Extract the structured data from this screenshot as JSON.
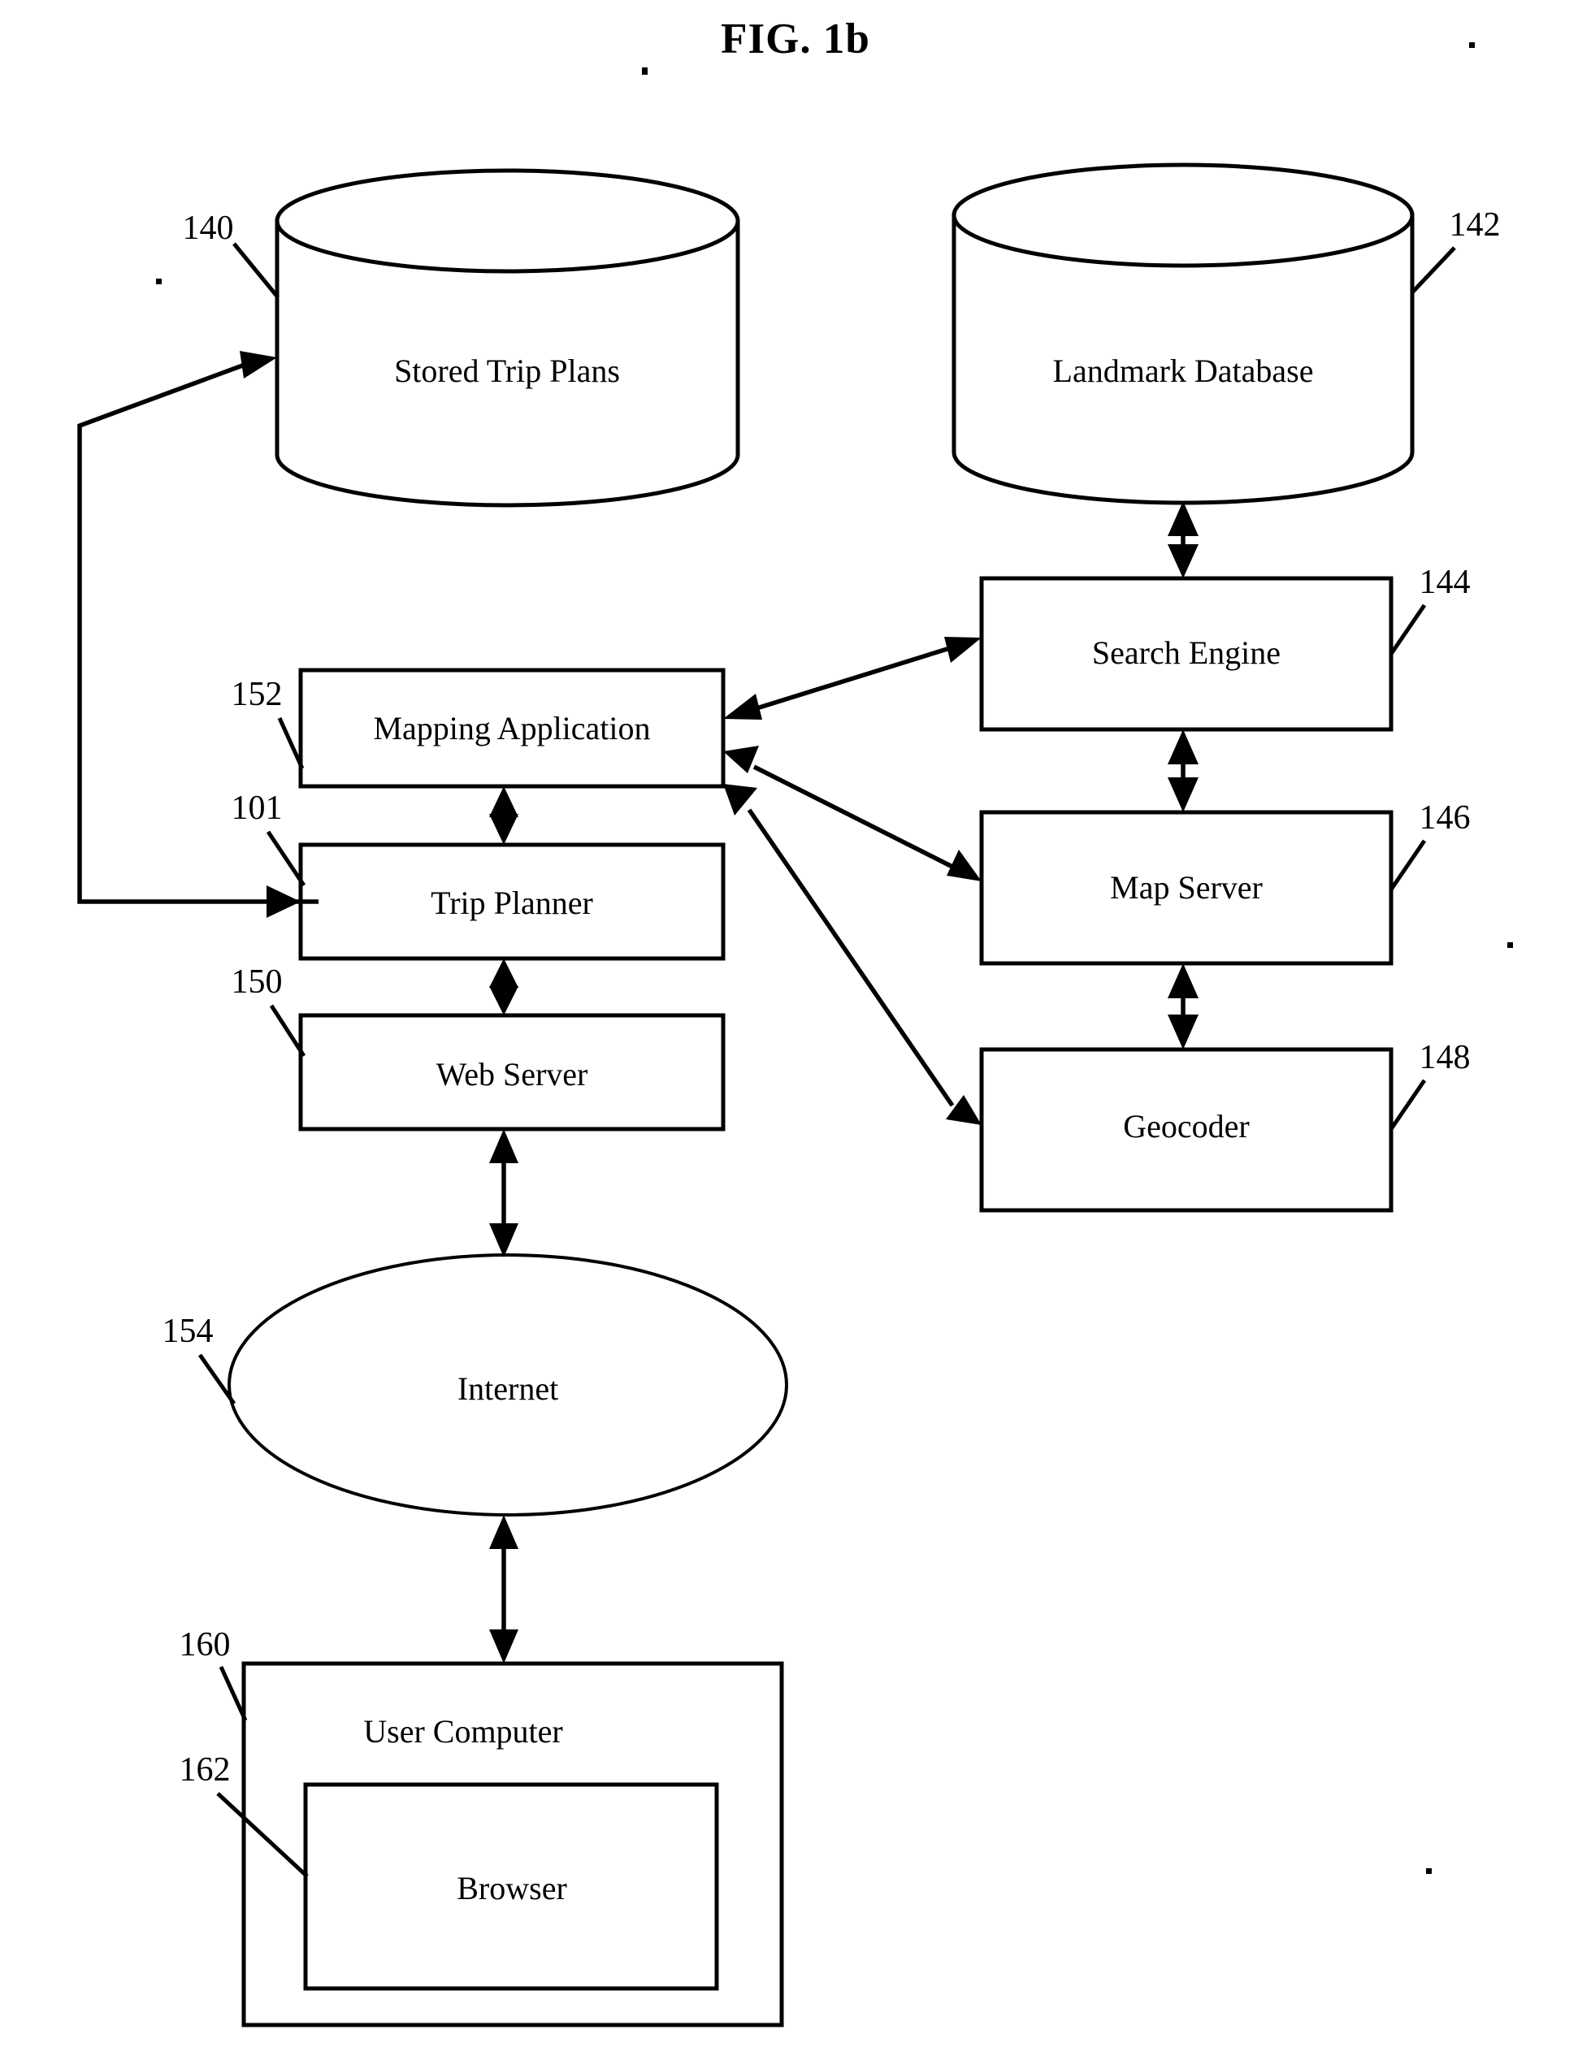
{
  "figure": {
    "title": "FIG. 1b",
    "type": "patent-block-diagram"
  },
  "nodes": {
    "stored_trip_plans": {
      "label": "Stored Trip Plans",
      "ref": "140",
      "shape": "cylinder"
    },
    "landmark_database": {
      "label": "Landmark Database",
      "ref": "142",
      "shape": "cylinder"
    },
    "search_engine": {
      "label": "Search Engine",
      "ref": "144",
      "shape": "rectangle"
    },
    "map_server": {
      "label": "Map Server",
      "ref": "146",
      "shape": "rectangle"
    },
    "geocoder": {
      "label": "Geocoder",
      "ref": "148",
      "shape": "rectangle"
    },
    "mapping_application": {
      "label": "Mapping Application",
      "ref": "152",
      "shape": "rectangle"
    },
    "trip_planner": {
      "label": "Trip Planner",
      "ref": "101",
      "shape": "rectangle"
    },
    "web_server": {
      "label": "Web Server",
      "ref": "150",
      "shape": "rectangle"
    },
    "internet": {
      "label": "Internet",
      "ref": "154",
      "shape": "ellipse"
    },
    "user_computer": {
      "label": "User Computer",
      "ref": "160",
      "shape": "rectangle"
    },
    "browser": {
      "label": "Browser",
      "ref": "162",
      "shape": "rectangle"
    }
  },
  "connections": [
    {
      "from": "trip_planner",
      "to": "stored_trip_plans",
      "arrows": "both",
      "style": "orthogonal-left-loop"
    },
    {
      "from": "landmark_database",
      "to": "search_engine",
      "arrows": "both",
      "style": "vertical"
    },
    {
      "from": "search_engine",
      "to": "map_server",
      "arrows": "both",
      "style": "vertical"
    },
    {
      "from": "map_server",
      "to": "geocoder",
      "arrows": "both",
      "style": "vertical"
    },
    {
      "from": "mapping_application",
      "to": "search_engine",
      "arrows": "both",
      "style": "diagonal"
    },
    {
      "from": "mapping_application",
      "to": "map_server",
      "arrows": "both",
      "style": "diagonal"
    },
    {
      "from": "mapping_application",
      "to": "geocoder",
      "arrows": "both",
      "style": "diagonal"
    },
    {
      "from": "mapping_application",
      "to": "trip_planner",
      "arrows": "both",
      "style": "vertical"
    },
    {
      "from": "trip_planner",
      "to": "web_server",
      "arrows": "both",
      "style": "vertical"
    },
    {
      "from": "web_server",
      "to": "internet",
      "arrows": "both",
      "style": "vertical"
    },
    {
      "from": "internet",
      "to": "user_computer",
      "arrows": "both",
      "style": "vertical"
    }
  ],
  "colors": {
    "stroke": "#000000",
    "background": "#ffffff",
    "text": "#000000"
  }
}
